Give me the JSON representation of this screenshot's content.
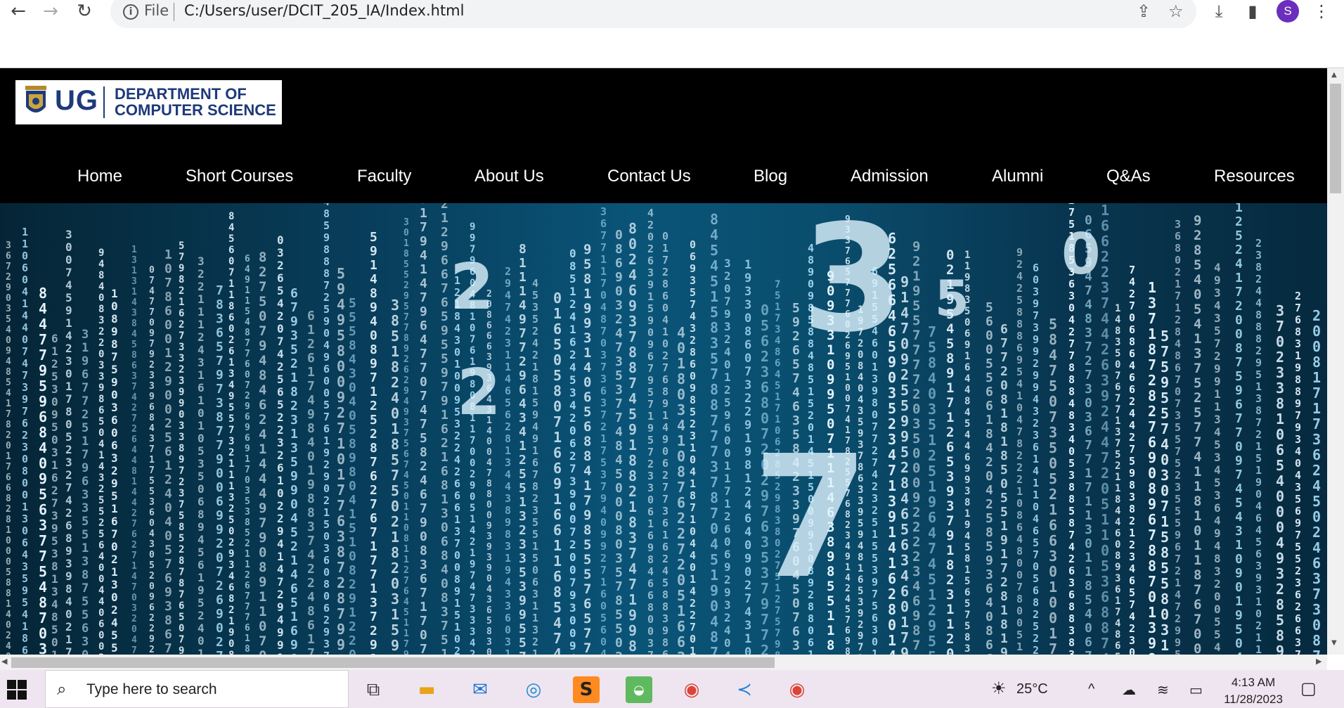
{
  "browser": {
    "omnibox": {
      "scheme_label": "File",
      "url": "C:/Users/user/DCIT_205_IA/Index.html"
    },
    "profile_initial": "S"
  },
  "site": {
    "logo": {
      "ug": "UG",
      "line1": "DEPARTMENT OF",
      "line2": "COMPUTER SCIENCE"
    },
    "nav": [
      {
        "label": "Home"
      },
      {
        "label": "Short Courses"
      },
      {
        "label": "Faculty"
      },
      {
        "label": "About Us"
      },
      {
        "label": "Contact Us"
      },
      {
        "label": "Blog"
      },
      {
        "label": "Admission"
      },
      {
        "label": "Alumni"
      },
      {
        "label": "Q&As"
      },
      {
        "label": "Resources"
      }
    ]
  },
  "taskbar": {
    "search_placeholder": "Type here to search",
    "weather": "25°C",
    "time": "4:13 AM",
    "date": "11/28/2023"
  },
  "colors": {
    "header_bg": "#000000",
    "logo_text": "#1f3a7a",
    "hero_tint": "#0a5478"
  }
}
